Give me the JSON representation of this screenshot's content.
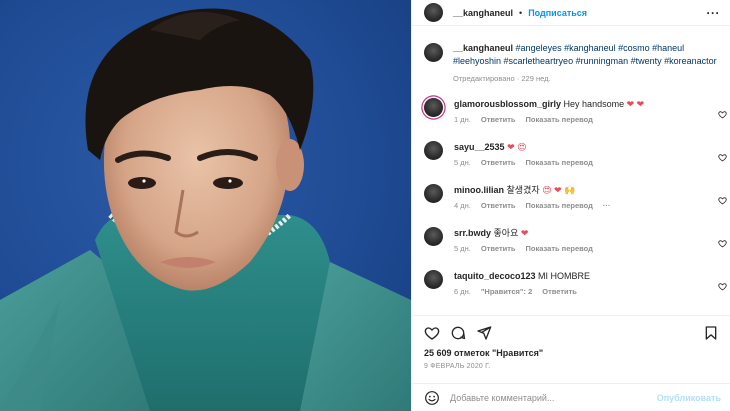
{
  "post": {
    "author": "__kanghaneul",
    "follow_label": "Подписаться",
    "more_label": "···",
    "caption_hashtags": "#angeleyes #kanghaneul #cosmo #haneul #leehyoshin #scarletheartryeo #runningman #twenty #koreanactor",
    "edited_label": "Отредактировано · 229 нед.",
    "likes_label": "25 609 отметок \"Нравится\"",
    "date_label": "9 ФЕВРАЛЬ 2020 Г.",
    "add_comment_placeholder": "Добавьте комментарий...",
    "publish_label": "Опубликовать"
  },
  "comments": [
    {
      "user": "glamorousblossom_girly",
      "text": "Hey handsome ",
      "emoji": "❤ ❤",
      "time": "1 дн.",
      "reply": "Ответить",
      "translate": "Показать перевод",
      "extra": ""
    },
    {
      "user": "sayu__2535",
      "text": "",
      "emoji": "❤ 😍",
      "time": "5 дн.",
      "reply": "Ответить",
      "translate": "Показать перевод",
      "extra": ""
    },
    {
      "user": "minoo.lilian",
      "text": "찰생겼자",
      "emoji": "😍 ❤ 🙌",
      "time": "4 дн.",
      "reply": "Ответить",
      "translate": "Показать перевод",
      "extra": "···"
    },
    {
      "user": "srr.bwdy",
      "text": "좋아요",
      "emoji": "❤",
      "time": "5 дн.",
      "reply": "Ответить",
      "translate": "Показать перевод",
      "extra": ""
    },
    {
      "user": "taquito_decoco123",
      "text": "MI HOMBRE",
      "emoji": "",
      "time": "6 дн.",
      "likes": "\"Нравится\": 2",
      "reply": "Ответить",
      "translate": "",
      "extra": ""
    }
  ],
  "icons": [
    "heart-icon",
    "comment-icon",
    "share-icon",
    "bookmark-icon",
    "emoji-icon",
    "more-icon"
  ],
  "colors": {
    "accent": "#0095f6",
    "link": "#00376b",
    "heart": "#ed4956",
    "muted": "#8e8e8e"
  }
}
